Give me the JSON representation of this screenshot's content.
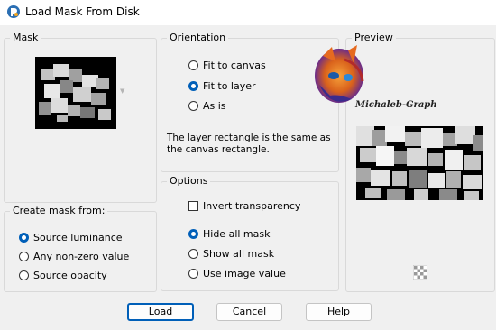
{
  "window": {
    "title": "Load Mask From Disk",
    "app_icon": "paintshop-pro-icon"
  },
  "mask": {
    "legend": "Mask",
    "thumbnail_icon": "mask-thumbnail",
    "dropdown_icon": "chevron-down-icon"
  },
  "create_mask_from": {
    "legend": "Create mask from:",
    "options": [
      {
        "label": "Source luminance",
        "selected": true
      },
      {
        "label": "Any non-zero value",
        "selected": false
      },
      {
        "label": "Source opacity",
        "selected": false
      }
    ]
  },
  "orientation": {
    "legend": "Orientation",
    "options": [
      {
        "label": "Fit to canvas",
        "selected": false
      },
      {
        "label": "Fit to layer",
        "selected": true
      },
      {
        "label": "As is",
        "selected": false
      }
    ],
    "description": "The layer rectangle is the same as the canvas rectangle."
  },
  "options": {
    "legend": "Options",
    "invert_label": "Invert transparency",
    "invert_checked": false,
    "choices": [
      {
        "label": "Hide all mask",
        "selected": true
      },
      {
        "label": "Show all mask",
        "selected": false
      },
      {
        "label": "Use image value",
        "selected": false
      }
    ]
  },
  "preview": {
    "legend": "Preview",
    "watermark": "Michaleb-Graph",
    "toggle_icon": "checkerboard-icon"
  },
  "buttons": {
    "load": "Load",
    "cancel": "Cancel",
    "help": "Help"
  },
  "colors": {
    "accent": "#005fb8",
    "background": "#f0f0f0"
  }
}
